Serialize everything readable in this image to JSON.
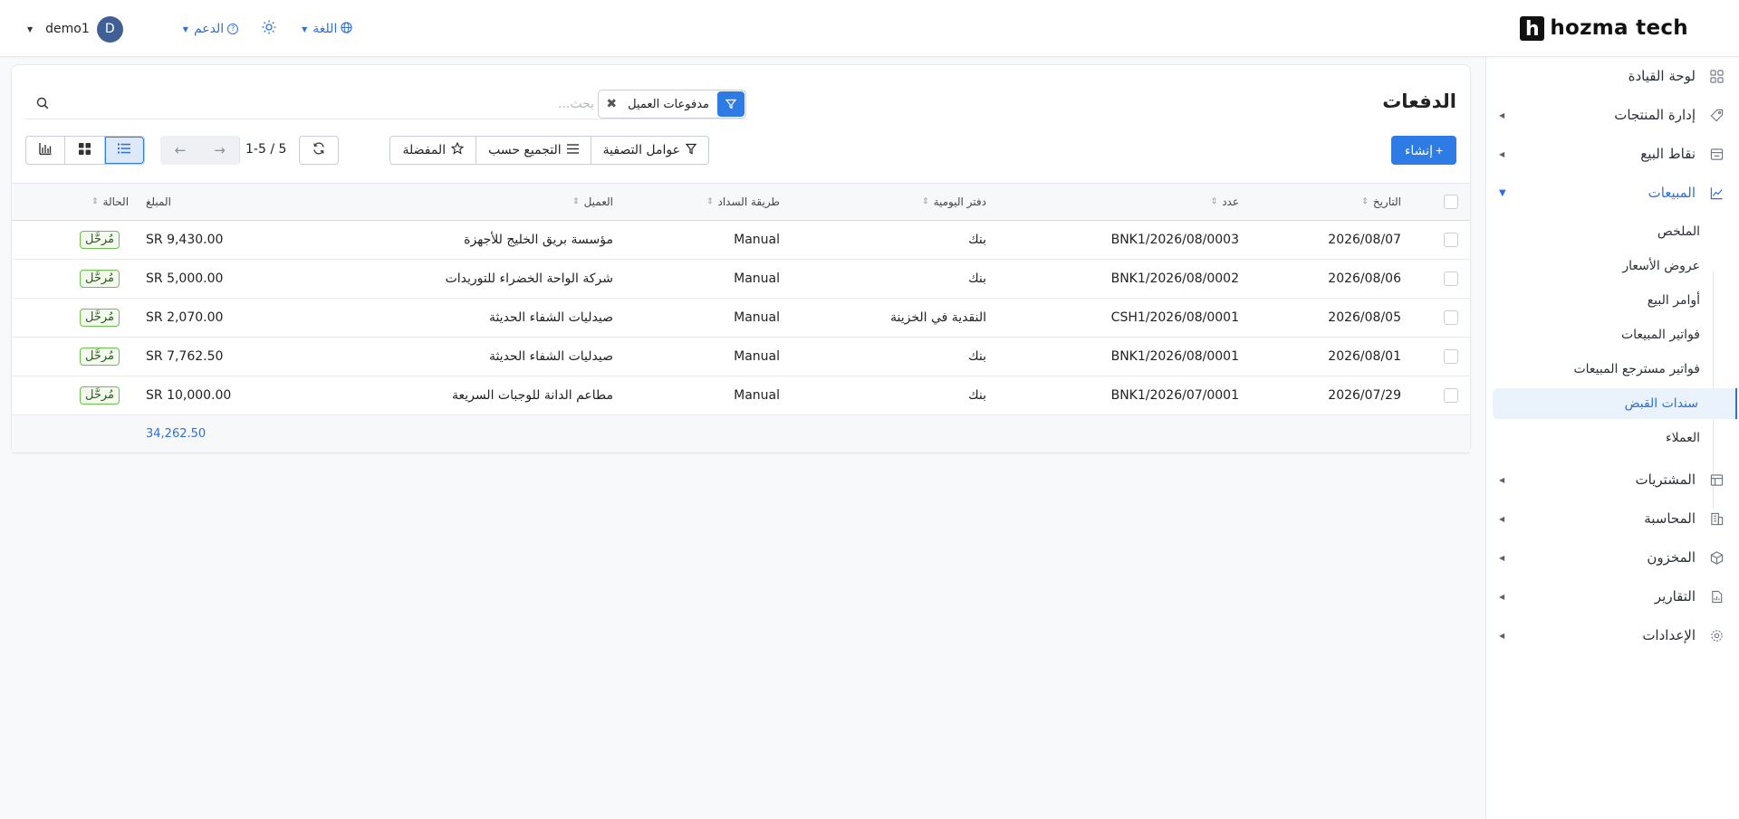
{
  "brand": {
    "name": "hozma tech",
    "mark": "h"
  },
  "topbar": {
    "user_name": "demo1",
    "avatar_initial": "D",
    "support_label": "الدعم",
    "language_label": "اللغة"
  },
  "sidebar": {
    "items": [
      {
        "label": "لوحة القيادة",
        "icon": "dashboard-icon",
        "has_caret": false
      },
      {
        "label": "إدارة المنتجات",
        "icon": "tag-icon",
        "has_caret": true
      },
      {
        "label": "نقاط البيع",
        "icon": "store-icon",
        "has_caret": true
      },
      {
        "label": "المبيعات",
        "icon": "chart-line-icon",
        "has_caret": true,
        "expanded": true
      },
      {
        "label": "المشتريات",
        "icon": "shop-icon",
        "has_caret": true
      },
      {
        "label": "المحاسبة",
        "icon": "building-icon",
        "has_caret": true
      },
      {
        "label": "المخزون",
        "icon": "box-icon",
        "has_caret": true
      },
      {
        "label": "التقارير",
        "icon": "report-icon",
        "has_caret": true
      },
      {
        "label": "الإعدادات",
        "icon": "gear-icon",
        "has_caret": true
      }
    ],
    "sales_sub": [
      "الملخص",
      "عروض الأسعار",
      "أوامر البيع",
      "فواتير المبيعات",
      "فواتير مسترجع المبيعات",
      "سندات القبض",
      "العملاء"
    ],
    "active_sub_index": 5
  },
  "page": {
    "title": "الدفعات",
    "search_placeholder": "بحث...",
    "facet_label": "مدفوعات العميل",
    "create_label": "إنشاء",
    "filters_label": "عوامل التصفية",
    "groupby_label": "التجميع حسب",
    "favorites_label": "المفضلة",
    "pager": "1-5 / 5"
  },
  "table": {
    "headers": [
      "التاريخ",
      "عدد",
      "دفتر اليومية",
      "طريقة السداد",
      "العميل",
      "المبلغ",
      "الحالة"
    ],
    "rows": [
      [
        "2026/08/07",
        "BNK1/2026/08/0003",
        "بنك",
        "Manual",
        "مؤسسة بريق الخليج للأجهزة",
        "SR 9,430.00",
        "مُرحَّل"
      ],
      [
        "2026/08/06",
        "BNK1/2026/08/0002",
        "بنك",
        "Manual",
        "شركة الواحة الخضراء للتوريدات",
        "SR 5,000.00",
        "مُرحَّل"
      ],
      [
        "2026/08/05",
        "CSH1/2026/08/0001",
        "النقدية في الخزينة",
        "Manual",
        "صيدليات الشفاء الحديثة",
        "SR 2,070.00",
        "مُرحَّل"
      ],
      [
        "2026/08/01",
        "BNK1/2026/08/0001",
        "بنك",
        "Manual",
        "صيدليات الشفاء الحديثة",
        "SR 7,762.50",
        "مُرحَّل"
      ],
      [
        "2026/07/29",
        "BNK1/2026/07/0001",
        "بنك",
        "Manual",
        "مطاعم الدانة للوجبات السريعة",
        "SR 10,000.00",
        "مُرحَّل"
      ]
    ],
    "total": "34,262.50"
  },
  "colors": {
    "accent": "#2f7be6",
    "posted_border": "#6cbf4b"
  }
}
